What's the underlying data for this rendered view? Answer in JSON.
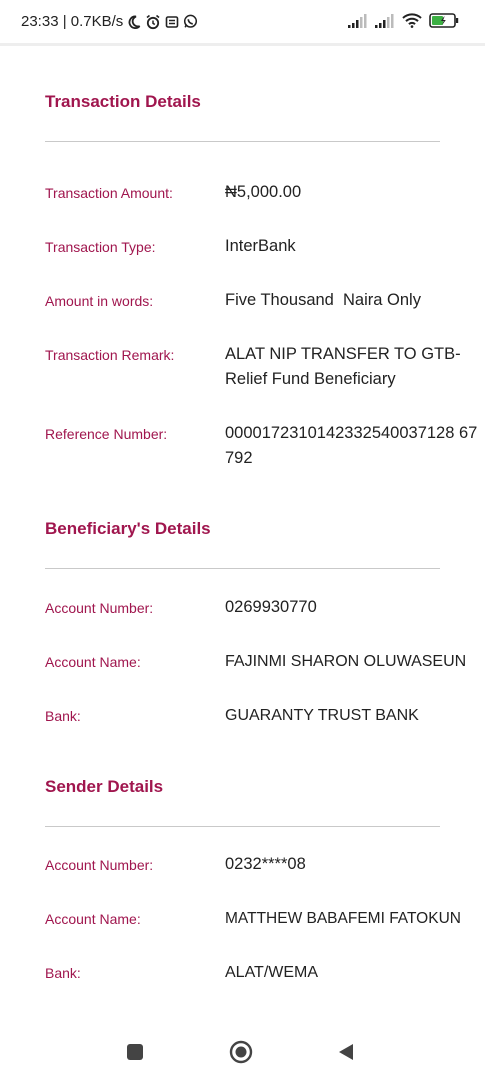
{
  "status_bar": {
    "time_speed": "23:33 | 0.7KB/s",
    "left_icons": [
      "moon-icon",
      "alarm-icon",
      "notification-icon",
      "whatsapp-icon"
    ],
    "right_icons": [
      "signal-bars-icon",
      "signal-bars-icon",
      "wifi-icon",
      "battery-charging-icon"
    ]
  },
  "transaction": {
    "title": "Transaction Details",
    "rows": [
      {
        "label": "Transaction Amount:",
        "value": "₦5,000.00"
      },
      {
        "label": "Transaction Type:",
        "value": "InterBank"
      },
      {
        "label": "Amount in words:",
        "value": "Five Thousand  Naira Only"
      },
      {
        "label": "Transaction Remark:",
        "value": "ALAT NIP TRANSFER TO GTB-Relief Fund Beneficiary"
      },
      {
        "label": "Reference Number:",
        "value": "0000172310142332540037128 67792"
      }
    ]
  },
  "beneficiary": {
    "title": "Beneficiary's Details",
    "rows": [
      {
        "label": "Account Number:",
        "value": "0269930770"
      },
      {
        "label": "Account Name:",
        "value": "FAJINMI SHARON OLUWASEUN"
      },
      {
        "label": "Bank:",
        "value": "GUARANTY TRUST BANK"
      }
    ]
  },
  "sender": {
    "title": "Sender Details",
    "rows": [
      {
        "label": "Account Number:",
        "value": "0232****08"
      },
      {
        "label": "Account Name:",
        "value": "MATTHEW BABAFEMI FATOKUN"
      },
      {
        "label": "Bank:",
        "value": "ALAT/WEMA"
      }
    ]
  },
  "nav": {
    "buttons": [
      "recents-square-icon",
      "home-circle-icon",
      "back-triangle-icon"
    ]
  },
  "colors": {
    "accent": "#a0164e",
    "text": "#222222",
    "divider": "#c9c9c9"
  }
}
